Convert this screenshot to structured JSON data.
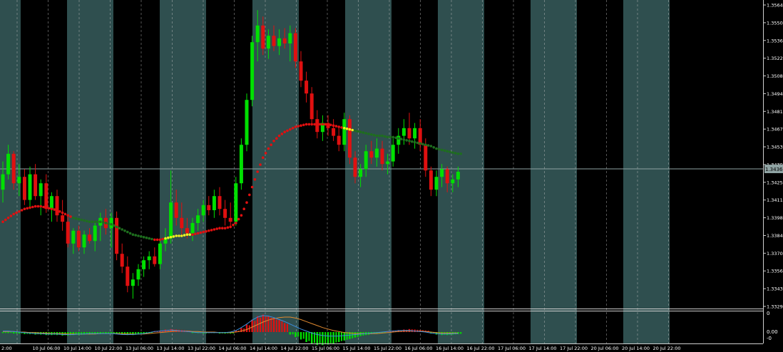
{
  "colors": {
    "background": "#000000",
    "session_band": "#2F4F4F",
    "bull_candle": "#00E000",
    "bear_candle": "#E01010",
    "ma_red": "#E01010",
    "ma_green": "#1E6E1E",
    "ma_yellow": "#F0F020",
    "axis_text": "#FFFFFF",
    "grid": "#C8C8C8",
    "price_line": "#8FA3A3",
    "macd_blue": "#3C8CDC",
    "macd_orange": "#E08A30"
  },
  "chart_data": {
    "type": "candlestick",
    "price_axis": {
      "ylim": [
        1.3329,
        1.3564
      ],
      "tick_labels": [
        "1.35640",
        "1.35500",
        "1.35365",
        "1.35225",
        "1.35085",
        "1.34945",
        "1.34810",
        "1.34670",
        "1.34530",
        "1.34395",
        "1.34255",
        "1.34115",
        "1.33980",
        "1.33840",
        "1.33705",
        "1.33565",
        "1.33430",
        "1.33290"
      ],
      "current_price": "1.34362"
    },
    "time_axis": {
      "labels": [
        "2:00",
        "10 Jul 06:00",
        "10 Jul 14:00",
        "10 Jul 22:00",
        "13 Jul 06:00",
        "13 Jul 14:00",
        "13 Jul 22:00",
        "14 Jul 06:00",
        "14 Jul 14:00",
        "14 Jul 22:00",
        "15 Jul 06:00",
        "15 Jul 14:00",
        "15 Jul 22:00",
        "16 Jul 06:00",
        "16 Jul 14:00",
        "16 Jul 22:00",
        "17 Jul 06:00",
        "17 Jul 14:00",
        "17 Jul 22:00",
        "20 Jul 06:00",
        "20 Jul 14:00",
        "20 Jul 22:00"
      ]
    },
    "indicator_axis": {
      "tick_labels": [
        "0",
        "0.00",
        "-0"
      ]
    },
    "candles": [
      {
        "o": 1.342,
        "h": 1.3442,
        "l": 1.341,
        "c": 1.3432
      },
      {
        "o": 1.3432,
        "h": 1.3455,
        "l": 1.3428,
        "c": 1.3448
      },
      {
        "o": 1.3448,
        "h": 1.345,
        "l": 1.342,
        "c": 1.3425
      },
      {
        "o": 1.3425,
        "h": 1.344,
        "l": 1.3415,
        "c": 1.343
      },
      {
        "o": 1.343,
        "h": 1.3436,
        "l": 1.3408,
        "c": 1.3412
      },
      {
        "o": 1.3412,
        "h": 1.3438,
        "l": 1.3405,
        "c": 1.3432
      },
      {
        "o": 1.3432,
        "h": 1.344,
        "l": 1.3412,
        "c": 1.3415
      },
      {
        "o": 1.3415,
        "h": 1.3428,
        "l": 1.34,
        "c": 1.3425
      },
      {
        "o": 1.3425,
        "h": 1.3432,
        "l": 1.3402,
        "c": 1.3405
      },
      {
        "o": 1.3405,
        "h": 1.3418,
        "l": 1.3395,
        "c": 1.3415
      },
      {
        "o": 1.3415,
        "h": 1.342,
        "l": 1.3395,
        "c": 1.34
      },
      {
        "o": 1.34,
        "h": 1.3412,
        "l": 1.3388,
        "c": 1.3395
      },
      {
        "o": 1.3395,
        "h": 1.34,
        "l": 1.3375,
        "c": 1.3378
      },
      {
        "o": 1.3378,
        "h": 1.339,
        "l": 1.337,
        "c": 1.3388
      },
      {
        "o": 1.3388,
        "h": 1.3392,
        "l": 1.3372,
        "c": 1.3375
      },
      {
        "o": 1.3375,
        "h": 1.3388,
        "l": 1.337,
        "c": 1.3385
      },
      {
        "o": 1.3385,
        "h": 1.339,
        "l": 1.3378,
        "c": 1.338
      },
      {
        "o": 1.338,
        "h": 1.3395,
        "l": 1.3372,
        "c": 1.3392
      },
      {
        "o": 1.3392,
        "h": 1.3402,
        "l": 1.338,
        "c": 1.3398
      },
      {
        "o": 1.3398,
        "h": 1.3405,
        "l": 1.3385,
        "c": 1.339
      },
      {
        "o": 1.339,
        "h": 1.3402,
        "l": 1.3375,
        "c": 1.3398
      },
      {
        "o": 1.3398,
        "h": 1.3403,
        "l": 1.3365,
        "c": 1.337
      },
      {
        "o": 1.337,
        "h": 1.3378,
        "l": 1.3355,
        "c": 1.336
      },
      {
        "o": 1.336,
        "h": 1.3368,
        "l": 1.334,
        "c": 1.3345
      },
      {
        "o": 1.3345,
        "h": 1.3355,
        "l": 1.3335,
        "c": 1.335
      },
      {
        "o": 1.335,
        "h": 1.3362,
        "l": 1.3345,
        "c": 1.3358
      },
      {
        "o": 1.3358,
        "h": 1.3368,
        "l": 1.3352,
        "c": 1.3365
      },
      {
        "o": 1.3365,
        "h": 1.3372,
        "l": 1.3358,
        "c": 1.3368
      },
      {
        "o": 1.3368,
        "h": 1.3375,
        "l": 1.336,
        "c": 1.3362
      },
      {
        "o": 1.3362,
        "h": 1.338,
        "l": 1.3358,
        "c": 1.3378
      },
      {
        "o": 1.3378,
        "h": 1.339,
        "l": 1.3372,
        "c": 1.3382
      },
      {
        "o": 1.3382,
        "h": 1.3435,
        "l": 1.3378,
        "c": 1.341
      },
      {
        "o": 1.341,
        "h": 1.342,
        "l": 1.3392,
        "c": 1.3398
      },
      {
        "o": 1.3398,
        "h": 1.341,
        "l": 1.3385,
        "c": 1.339
      },
      {
        "o": 1.339,
        "h": 1.3398,
        "l": 1.3382,
        "c": 1.3386
      },
      {
        "o": 1.3386,
        "h": 1.3398,
        "l": 1.338,
        "c": 1.3394
      },
      {
        "o": 1.3394,
        "h": 1.3405,
        "l": 1.3388,
        "c": 1.34
      },
      {
        "o": 1.34,
        "h": 1.3412,
        "l": 1.3395,
        "c": 1.3408
      },
      {
        "o": 1.3408,
        "h": 1.3415,
        "l": 1.34,
        "c": 1.3404
      },
      {
        "o": 1.3404,
        "h": 1.342,
        "l": 1.3398,
        "c": 1.3415
      },
      {
        "o": 1.3415,
        "h": 1.3422,
        "l": 1.34,
        "c": 1.3405
      },
      {
        "o": 1.3405,
        "h": 1.3412,
        "l": 1.3392,
        "c": 1.3398
      },
      {
        "o": 1.3398,
        "h": 1.341,
        "l": 1.339,
        "c": 1.3395
      },
      {
        "o": 1.3395,
        "h": 1.343,
        "l": 1.3392,
        "c": 1.3425
      },
      {
        "o": 1.3425,
        "h": 1.346,
        "l": 1.342,
        "c": 1.3455
      },
      {
        "o": 1.3455,
        "h": 1.3495,
        "l": 1.345,
        "c": 1.349
      },
      {
        "o": 1.349,
        "h": 1.354,
        "l": 1.3485,
        "c": 1.3535
      },
      {
        "o": 1.3535,
        "h": 1.356,
        "l": 1.352,
        "c": 1.3548
      },
      {
        "o": 1.3548,
        "h": 1.3555,
        "l": 1.3525,
        "c": 1.353
      },
      {
        "o": 1.353,
        "h": 1.3545,
        "l": 1.3522,
        "c": 1.354
      },
      {
        "o": 1.354,
        "h": 1.3548,
        "l": 1.3528,
        "c": 1.3532
      },
      {
        "o": 1.3532,
        "h": 1.3545,
        "l": 1.3525,
        "c": 1.3538
      },
      {
        "o": 1.3538,
        "h": 1.3546,
        "l": 1.353,
        "c": 1.3534
      },
      {
        "o": 1.3534,
        "h": 1.3548,
        "l": 1.352,
        "c": 1.3542
      },
      {
        "o": 1.3542,
        "h": 1.3546,
        "l": 1.3515,
        "c": 1.352
      },
      {
        "o": 1.352,
        "h": 1.3528,
        "l": 1.35,
        "c": 1.3505
      },
      {
        "o": 1.3505,
        "h": 1.3512,
        "l": 1.3488,
        "c": 1.3495
      },
      {
        "o": 1.3495,
        "h": 1.35,
        "l": 1.347,
        "c": 1.3475
      },
      {
        "o": 1.3475,
        "h": 1.3482,
        "l": 1.346,
        "c": 1.3465
      },
      {
        "o": 1.3465,
        "h": 1.3478,
        "l": 1.3458,
        "c": 1.3472
      },
      {
        "o": 1.3472,
        "h": 1.3478,
        "l": 1.3462,
        "c": 1.3468
      },
      {
        "o": 1.3468,
        "h": 1.3475,
        "l": 1.3458,
        "c": 1.3462
      },
      {
        "o": 1.3462,
        "h": 1.347,
        "l": 1.345,
        "c": 1.3455
      },
      {
        "o": 1.3455,
        "h": 1.348,
        "l": 1.345,
        "c": 1.3475
      },
      {
        "o": 1.3475,
        "h": 1.3478,
        "l": 1.344,
        "c": 1.3445
      },
      {
        "o": 1.3445,
        "h": 1.345,
        "l": 1.3425,
        "c": 1.343
      },
      {
        "o": 1.343,
        "h": 1.344,
        "l": 1.3422,
        "c": 1.3436
      },
      {
        "o": 1.3436,
        "h": 1.3455,
        "l": 1.343,
        "c": 1.345
      },
      {
        "o": 1.345,
        "h": 1.3458,
        "l": 1.344,
        "c": 1.3445
      },
      {
        "o": 1.3445,
        "h": 1.346,
        "l": 1.3438,
        "c": 1.3452
      },
      {
        "o": 1.3452,
        "h": 1.3458,
        "l": 1.3435,
        "c": 1.344
      },
      {
        "o": 1.344,
        "h": 1.3448,
        "l": 1.3432,
        "c": 1.3442
      },
      {
        "o": 1.3442,
        "h": 1.346,
        "l": 1.3438,
        "c": 1.3455
      },
      {
        "o": 1.3455,
        "h": 1.3468,
        "l": 1.3448,
        "c": 1.3462
      },
      {
        "o": 1.3462,
        "h": 1.3475,
        "l": 1.3455,
        "c": 1.3468
      },
      {
        "o": 1.3468,
        "h": 1.348,
        "l": 1.3455,
        "c": 1.346
      },
      {
        "o": 1.346,
        "h": 1.3472,
        "l": 1.3452,
        "c": 1.3468
      },
      {
        "o": 1.3468,
        "h": 1.3475,
        "l": 1.345,
        "c": 1.3455
      },
      {
        "o": 1.3455,
        "h": 1.346,
        "l": 1.343,
        "c": 1.3435
      },
      {
        "o": 1.3435,
        "h": 1.3438,
        "l": 1.3415,
        "c": 1.342
      },
      {
        "o": 1.342,
        "h": 1.3435,
        "l": 1.3415,
        "c": 1.343
      },
      {
        "o": 1.343,
        "h": 1.344,
        "l": 1.3422,
        "c": 1.3436
      },
      {
        "o": 1.3436,
        "h": 1.3438,
        "l": 1.3418,
        "c": 1.3425
      },
      {
        "o": 1.3425,
        "h": 1.3432,
        "l": 1.3418,
        "c": 1.3428
      },
      {
        "o": 1.3428,
        "h": 1.3438,
        "l": 1.3422,
        "c": 1.3434
      }
    ],
    "moving_average": [
      1.3395,
      1.3398,
      1.3401,
      1.3403,
      1.3405,
      1.3406,
      1.3407,
      1.3407,
      1.3406,
      1.3405,
      1.3404,
      1.3402,
      1.34,
      1.3398,
      1.3397,
      1.3396,
      1.3395,
      1.3395,
      1.3395,
      1.3394,
      1.3393,
      1.3391,
      1.3389,
      1.3387,
      1.3385,
      1.3384,
      1.3383,
      1.3382,
      1.3381,
      1.3381,
      1.3382,
      1.3383,
      1.3384,
      1.3384,
      1.3385,
      1.3385,
      1.3386,
      1.3387,
      1.3388,
      1.3389,
      1.339,
      1.339,
      1.3391,
      1.3394,
      1.34,
      1.341,
      1.3422,
      1.3434,
      1.3445,
      1.3452,
      1.3458,
      1.3462,
      1.3465,
      1.3467,
      1.3469,
      1.347,
      1.3471,
      1.3471,
      1.3471,
      1.3471,
      1.3471,
      1.347,
      1.3469,
      1.3468,
      1.3467,
      1.3466,
      1.3465,
      1.3464,
      1.3463,
      1.3462,
      1.3462,
      1.3461,
      1.3461,
      1.346,
      1.3459,
      1.3458,
      1.3457,
      1.3456,
      1.3455,
      1.3454,
      1.3452,
      1.3451,
      1.345,
      1.3449,
      1.3448
    ],
    "ma_colors": [
      "r",
      "r",
      "r",
      "r",
      "r",
      "r",
      "r",
      "r",
      "r",
      "r",
      "r",
      "r",
      "r",
      "g",
      "g",
      "g",
      "g",
      "g",
      "g",
      "g",
      "g",
      "g",
      "g",
      "g",
      "g",
      "g",
      "g",
      "g",
      "r",
      "r",
      "y",
      "y",
      "y",
      "y",
      "y",
      "r",
      "r",
      "r",
      "r",
      "r",
      "r",
      "r",
      "r",
      "r",
      "r",
      "r",
      "r",
      "r",
      "r",
      "r",
      "r",
      "r",
      "r",
      "r",
      "r",
      "r",
      "r",
      "r",
      "r",
      "r",
      "r",
      "r",
      "r",
      "y",
      "y",
      "g",
      "g",
      "g",
      "g",
      "g",
      "g",
      "g",
      "g",
      "g",
      "g",
      "g",
      "g",
      "g",
      "g",
      "g",
      "g",
      "g",
      "g",
      "g",
      "g"
    ],
    "macd_histogram": [
      -0.2,
      -0.2,
      -0.3,
      -0.3,
      -0.4,
      -0.4,
      -0.5,
      -0.5,
      -0.6,
      -0.6,
      -0.6,
      -0.7,
      -0.7,
      -0.6,
      -0.6,
      -0.5,
      -0.5,
      -0.4,
      -0.4,
      -0.3,
      -0.3,
      -0.4,
      -0.5,
      -0.6,
      -0.6,
      -0.5,
      -0.4,
      -0.2,
      0.2,
      0.3,
      0.5,
      0.6,
      0.5,
      0.4,
      0.3,
      -0.2,
      -0.2,
      -0.3,
      -0.2,
      -0.2,
      -0.3,
      -0.3,
      -0.3,
      0.3,
      0.8,
      1.5,
      2.5,
      3.2,
      3.5,
      3.2,
      2.8,
      2.4,
      1.8,
      -0.5,
      -1.0,
      -1.5,
      -2.0,
      -2.4,
      -2.6,
      -2.6,
      -2.5,
      -2.3,
      -2.0,
      -1.7,
      -1.4,
      -1.1,
      -0.8,
      -0.6,
      -0.4,
      -0.3,
      -0.2,
      0.2,
      0.3,
      0.4,
      0.5,
      0.6,
      0.5,
      0.4,
      0.3,
      -0.3,
      -0.5,
      -0.6,
      -0.6,
      -0.5,
      -0.4
    ],
    "macd_line": [
      0.2,
      0.2,
      0.1,
      0.0,
      -0.1,
      -0.2,
      -0.3,
      -0.3,
      -0.4,
      -0.4,
      -0.4,
      -0.5,
      -0.5,
      -0.5,
      -0.4,
      -0.4,
      -0.3,
      -0.3,
      -0.3,
      -0.3,
      -0.3,
      -0.4,
      -0.5,
      -0.5,
      -0.5,
      -0.4,
      -0.3,
      -0.1,
      0.1,
      0.2,
      0.3,
      0.4,
      0.3,
      0.2,
      0.1,
      0.0,
      -0.1,
      -0.1,
      -0.1,
      -0.1,
      -0.1,
      -0.1,
      0.0,
      0.3,
      0.9,
      1.6,
      2.4,
      3.0,
      3.3,
      3.2,
      2.9,
      2.5,
      2.1,
      1.6,
      1.1,
      0.6,
      0.2,
      -0.2,
      -0.5,
      -0.7,
      -0.8,
      -0.8,
      -0.8,
      -0.7,
      -0.6,
      -0.5,
      -0.4,
      -0.3,
      -0.2,
      -0.1,
      0.0,
      0.1,
      0.2,
      0.3,
      0.3,
      0.3,
      0.2,
      0.1,
      0.0,
      -0.2,
      -0.3,
      -0.4,
      -0.4,
      -0.3,
      -0.3
    ],
    "signal_line": [
      0.1,
      0.1,
      0.1,
      0.0,
      0.0,
      -0.1,
      -0.1,
      -0.2,
      -0.2,
      -0.3,
      -0.3,
      -0.3,
      -0.4,
      -0.4,
      -0.4,
      -0.4,
      -0.4,
      -0.4,
      -0.3,
      -0.3,
      -0.3,
      -0.3,
      -0.3,
      -0.4,
      -0.4,
      -0.4,
      -0.4,
      -0.3,
      -0.2,
      -0.1,
      0.0,
      0.1,
      0.2,
      0.2,
      0.2,
      0.1,
      0.1,
      0.0,
      0.0,
      0.0,
      -0.1,
      -0.1,
      -0.1,
      0.0,
      0.2,
      0.5,
      1.0,
      1.5,
      2.0,
      2.4,
      2.7,
      2.9,
      3.0,
      3.0,
      2.8,
      2.5,
      2.1,
      1.7,
      1.3,
      0.9,
      0.6,
      0.3,
      0.1,
      -0.1,
      -0.2,
      -0.3,
      -0.3,
      -0.3,
      -0.3,
      -0.3,
      -0.2,
      -0.1,
      0.0,
      0.1,
      0.2,
      0.2,
      0.2,
      0.2,
      0.1,
      0.0,
      -0.1,
      -0.2,
      -0.2,
      -0.2,
      -0.2
    ]
  }
}
